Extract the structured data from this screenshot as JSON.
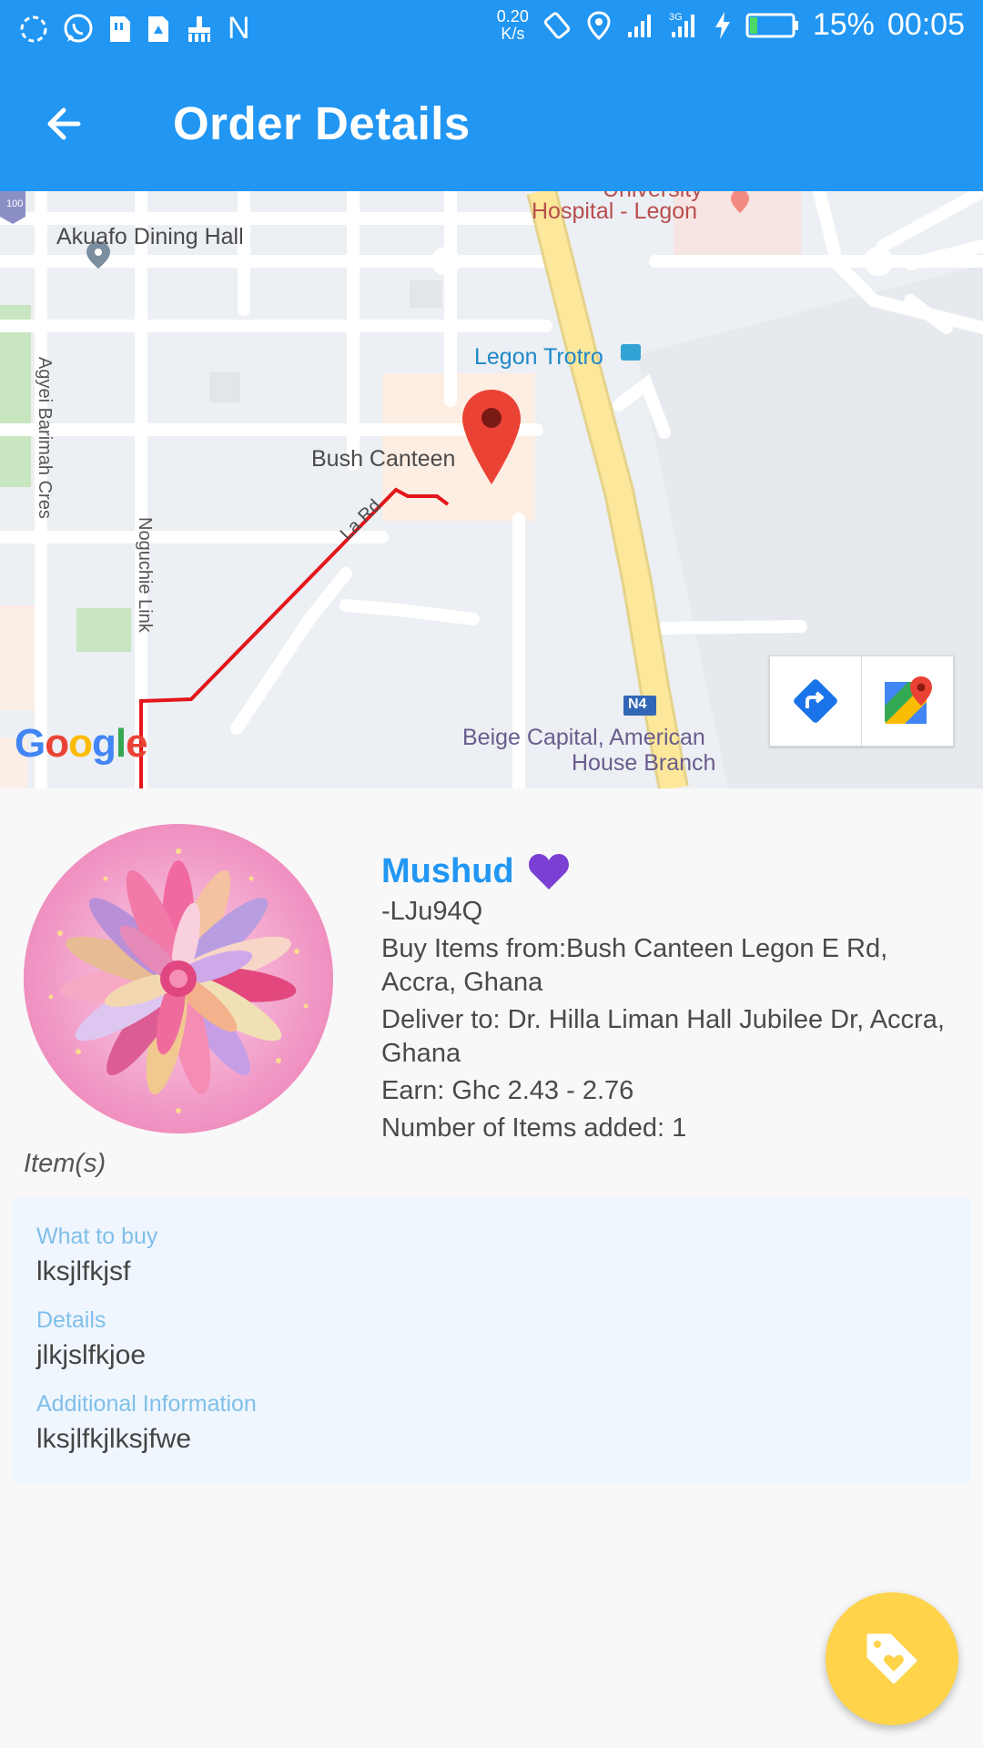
{
  "status_bar": {
    "speed_top": "0.20",
    "speed_bottom": "K/s",
    "battery": "15%",
    "time": "00:05",
    "letter": "N"
  },
  "toolbar": {
    "title": "Order Details"
  },
  "map": {
    "labels": {
      "dining_hall": "Akuafo Dining Hall",
      "hospital_top": "University",
      "hospital": "Hospital - Legon",
      "trotro": "Legon Trotro",
      "canteen": "Bush Canteen",
      "agyei": "Agyei Barimah Cres",
      "noguchi": "Noguchie Link",
      "la_rd": "La Rd",
      "beige1": "Beige Capital, American",
      "beige2": "House Branch",
      "road_badge": "N4",
      "poi_badge": "100"
    },
    "google_logo": [
      "G",
      "o",
      "o",
      "g",
      "l",
      "e"
    ]
  },
  "order": {
    "name": "Mushud",
    "code": "-LJu94Q",
    "buy_from": "Buy Items from:Bush Canteen Legon E Rd, Accra, Ghana",
    "deliver_to": "Deliver to: Dr. Hilla Liman Hall Jubilee Dr, Accra, Ghana",
    "earn": "Earn: Ghc 2.43 - 2.76",
    "item_count": "Number of Items added: 1",
    "items_heading": "Item(s)"
  },
  "items": [
    {
      "label": "What to buy",
      "value": "lksjlfkjsf"
    },
    {
      "label": "Details",
      "value": "jlkjslfkjoe"
    },
    {
      "label": "Additional Information",
      "value": "lksjlfkjlksjfwe"
    }
  ],
  "colors": {
    "primary": "#2196f3",
    "fab": "#ffd34a",
    "heart": "#7b3fd4"
  }
}
